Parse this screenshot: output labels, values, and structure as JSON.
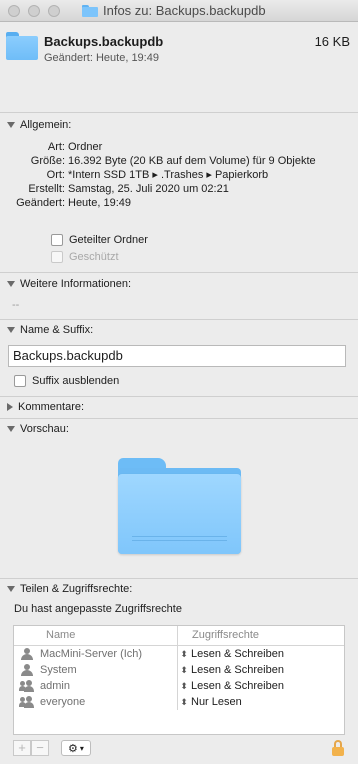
{
  "window": {
    "title": "Infos zu: Backups.backupdb"
  },
  "header": {
    "name": "Backups.backupdb",
    "size": "16 KB",
    "modified": "Geändert: Heute, 19:49"
  },
  "general": {
    "title": "Allgemein:",
    "rows": [
      {
        "label": "Art:",
        "value": "Ordner"
      },
      {
        "label": "Größe:",
        "value": "16.392 Byte (20 KB auf dem Volume) für 9 Objekte"
      },
      {
        "label": "Ort:",
        "value": "*Intern SSD 1TB ▸ .Trashes ▸ Papierkorb"
      },
      {
        "label": "Erstellt:",
        "value": "Samstag, 25. Juli 2020 um 02:21"
      },
      {
        "label": "Geändert:",
        "value": "Heute, 19:49"
      }
    ],
    "shared_folder": "Geteilter Ordner",
    "locked": "Geschützt"
  },
  "more_info": {
    "title": "Weitere Informationen:",
    "value": "--"
  },
  "name_ext": {
    "title": "Name & Suffix:",
    "value": "Backups.backupdb",
    "hide_ext": "Suffix ausblenden"
  },
  "comments": {
    "title": "Kommentare:"
  },
  "preview": {
    "title": "Vorschau:"
  },
  "sharing": {
    "title": "Teilen & Zugriffsrechte:",
    "note": "Du hast angepasste Zugriffsrechte",
    "col_name": "Name",
    "col_priv": "Zugriffsrechte",
    "rows": [
      {
        "name": "MacMini-Server (Ich)",
        "priv": "Lesen & Schreiben",
        "icon": "user-icon"
      },
      {
        "name": "System",
        "priv": "Lesen & Schreiben",
        "icon": "user-icon"
      },
      {
        "name": "admin",
        "priv": "Lesen & Schreiben",
        "icon": "group-icon"
      },
      {
        "name": "everyone",
        "priv": "Nur Lesen",
        "icon": "group-icon"
      }
    ],
    "add": "+",
    "remove": "−"
  }
}
